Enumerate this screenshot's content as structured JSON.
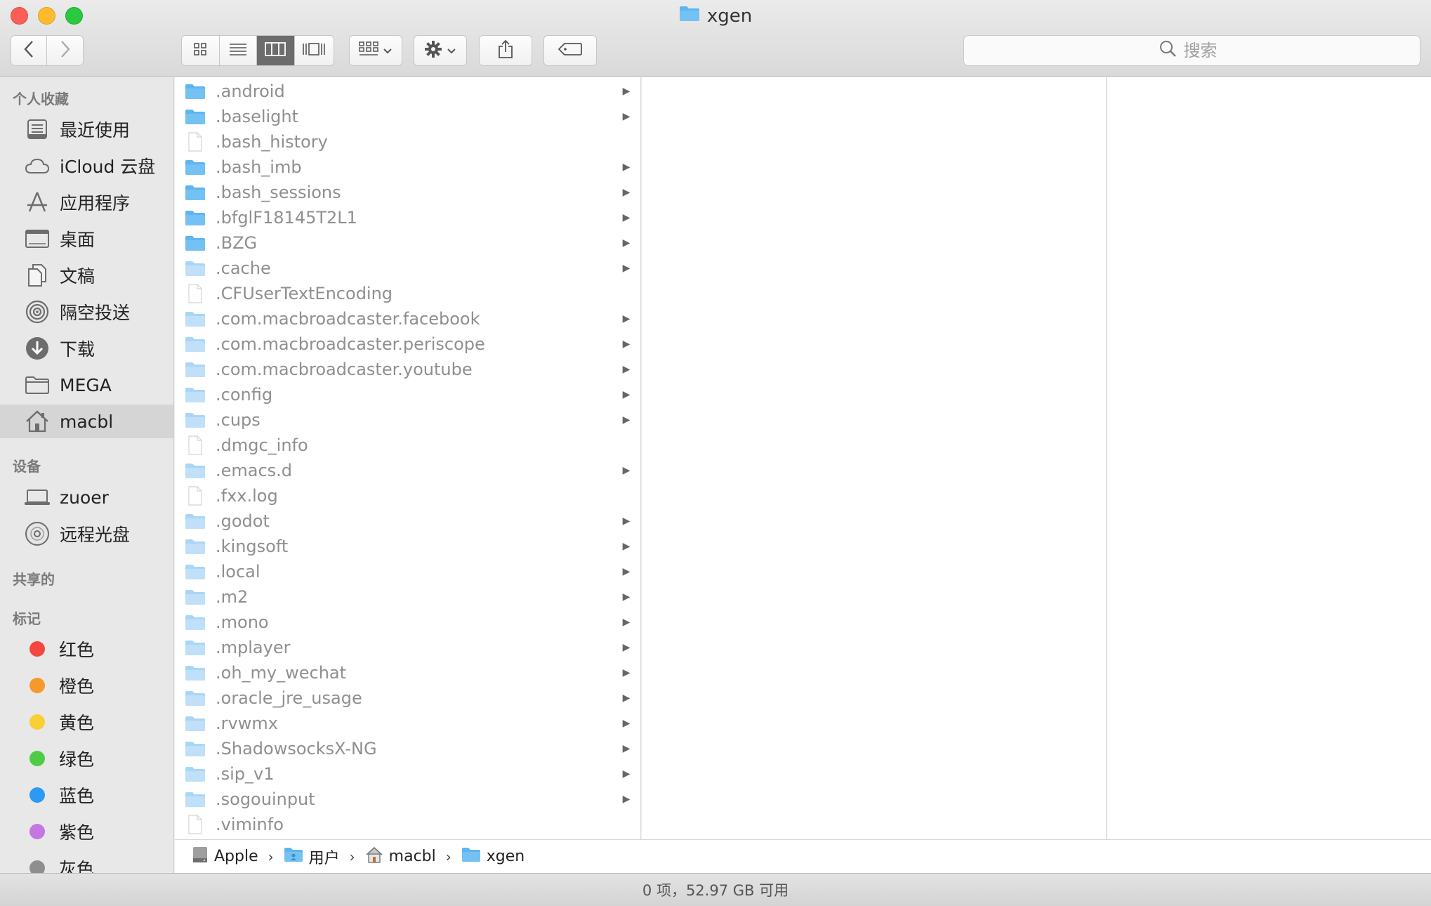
{
  "window": {
    "title": "xgen",
    "colors": {
      "folder_blue": "#5fb5ef",
      "folder_light": "#a9d6f6",
      "selection": "#d5d5d5"
    }
  },
  "toolbar": {
    "back_icon": "chevron-left-icon",
    "forward_icon": "chevron-right-icon",
    "view_modes": [
      "icon-view-icon",
      "list-view-icon",
      "column-view-icon",
      "cover-flow-icon"
    ],
    "active_view": "column-view-icon",
    "arrange_icon": "arrange-grid-icon",
    "action_icon": "gear-icon",
    "share_icon": "share-icon",
    "tag_icon": "tag-icon",
    "search_placeholder": "搜索"
  },
  "sidebar": {
    "favorites_header": "个人收藏",
    "favorites": [
      {
        "label": "最近使用",
        "icon": "recents-icon"
      },
      {
        "label": "iCloud 云盘",
        "icon": "cloud-icon"
      },
      {
        "label": "应用程序",
        "icon": "applications-icon"
      },
      {
        "label": "桌面",
        "icon": "desktop-icon"
      },
      {
        "label": "文稿",
        "icon": "documents-icon"
      },
      {
        "label": "隔空投送",
        "icon": "airdrop-icon"
      },
      {
        "label": "下载",
        "icon": "downloads-icon"
      },
      {
        "label": "MEGA",
        "icon": "folder-icon"
      },
      {
        "label": "macbl",
        "icon": "home-icon",
        "selected": true
      }
    ],
    "devices_header": "设备",
    "devices": [
      {
        "label": "zuoer",
        "icon": "laptop-icon"
      },
      {
        "label": "远程光盘",
        "icon": "disc-icon"
      }
    ],
    "shared_header": "共享的",
    "tags_header": "标记",
    "tags": [
      {
        "label": "红色",
        "color": "#f4473f"
      },
      {
        "label": "橙色",
        "color": "#f7982c"
      },
      {
        "label": "黄色",
        "color": "#f9cf34"
      },
      {
        "label": "绿色",
        "color": "#4fcc46"
      },
      {
        "label": "蓝色",
        "color": "#2c9af4"
      },
      {
        "label": "紫色",
        "color": "#c576e3"
      },
      {
        "label": "灰色",
        "color": "#8e8e8e"
      }
    ]
  },
  "files": [
    {
      "name": ".android",
      "kind": "folder",
      "shade": "blue"
    },
    {
      "name": ".baselight",
      "kind": "folder",
      "shade": "blue"
    },
    {
      "name": ".bash_history",
      "kind": "file"
    },
    {
      "name": ".bash_imb",
      "kind": "folder",
      "shade": "blue"
    },
    {
      "name": ".bash_sessions",
      "kind": "folder",
      "shade": "blue"
    },
    {
      "name": ".bfglF18145T2L1",
      "kind": "folder",
      "shade": "blue"
    },
    {
      "name": ".BZG",
      "kind": "folder",
      "shade": "blue"
    },
    {
      "name": ".cache",
      "kind": "folder",
      "shade": "light"
    },
    {
      "name": ".CFUserTextEncoding",
      "kind": "file"
    },
    {
      "name": ".com.macbroadcaster.facebook",
      "kind": "folder",
      "shade": "light"
    },
    {
      "name": ".com.macbroadcaster.periscope",
      "kind": "folder",
      "shade": "light"
    },
    {
      "name": ".com.macbroadcaster.youtube",
      "kind": "folder",
      "shade": "light"
    },
    {
      "name": ".config",
      "kind": "folder",
      "shade": "light"
    },
    {
      "name": ".cups",
      "kind": "folder",
      "shade": "light"
    },
    {
      "name": ".dmgc_info",
      "kind": "file"
    },
    {
      "name": ".emacs.d",
      "kind": "folder",
      "shade": "light"
    },
    {
      "name": ".fxx.log",
      "kind": "file"
    },
    {
      "name": ".godot",
      "kind": "folder",
      "shade": "light"
    },
    {
      "name": ".kingsoft",
      "kind": "folder",
      "shade": "light"
    },
    {
      "name": ".local",
      "kind": "folder",
      "shade": "light"
    },
    {
      "name": ".m2",
      "kind": "folder",
      "shade": "light"
    },
    {
      "name": ".mono",
      "kind": "folder",
      "shade": "light"
    },
    {
      "name": ".mplayer",
      "kind": "folder",
      "shade": "light"
    },
    {
      "name": ".oh_my_wechat",
      "kind": "folder",
      "shade": "light"
    },
    {
      "name": ".oracle_jre_usage",
      "kind": "folder",
      "shade": "light"
    },
    {
      "name": ".rvwmx",
      "kind": "folder",
      "shade": "light"
    },
    {
      "name": ".ShadowsocksX-NG",
      "kind": "folder",
      "shade": "light"
    },
    {
      "name": ".sip_v1",
      "kind": "folder",
      "shade": "light"
    },
    {
      "name": ".sogouinput",
      "kind": "folder",
      "shade": "light"
    },
    {
      "name": ".viminfo",
      "kind": "file"
    }
  ],
  "pathbar": {
    "crumbs": [
      {
        "label": "Apple",
        "icon": "hard-drive-icon"
      },
      {
        "label": "用户",
        "icon": "users-folder-icon"
      },
      {
        "label": "macbl",
        "icon": "home-icon"
      },
      {
        "label": "xgen",
        "icon": "folder-icon"
      }
    ],
    "separator": "›"
  },
  "status": {
    "text": "0 项，52.97 GB 可用"
  }
}
